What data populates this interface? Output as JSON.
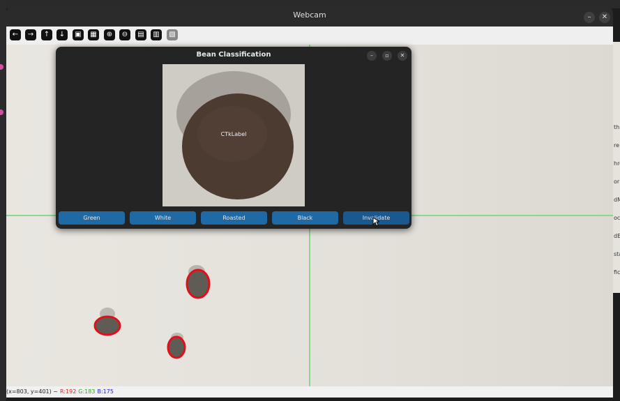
{
  "webcam": {
    "title": "Webcam",
    "toolbar": [
      {
        "icon": "arrow-left-icon",
        "glyph": "←"
      },
      {
        "icon": "arrow-right-icon",
        "glyph": "→"
      },
      {
        "icon": "arrow-up-icon",
        "glyph": "↑"
      },
      {
        "icon": "arrow-down-icon",
        "glyph": "↓"
      },
      {
        "icon": "zoom-fit-icon",
        "glyph": "▣"
      },
      {
        "icon": "zoom-original-icon",
        "glyph": "▦"
      },
      {
        "icon": "zoom-in-icon",
        "glyph": "⊕"
      },
      {
        "icon": "zoom-out-icon",
        "glyph": "⊖"
      },
      {
        "icon": "save-icon",
        "glyph": "▤"
      },
      {
        "icon": "copy-icon",
        "glyph": "▥"
      },
      {
        "icon": "properties-icon",
        "glyph": "▧"
      }
    ],
    "status": {
      "coords": "(x=803, y=401) ~",
      "r": "R:192",
      "g": "G:183",
      "b": "B:175"
    }
  },
  "dialog": {
    "title": "Bean Classification",
    "image_label": "CTkLabel",
    "buttons": [
      "Green",
      "White",
      "Roasted",
      "Black",
      "Invalidate"
    ]
  },
  "side_text": [
    "thr",
    "re",
    "hre",
    "or",
    "dM",
    "oc",
    "dE",
    "sta",
    "fic"
  ],
  "colors": {
    "button_blue": "#1f6aa5",
    "crosshair": "#8fd48f",
    "contour": "#e0101a",
    "dialog_bg": "#242424"
  }
}
